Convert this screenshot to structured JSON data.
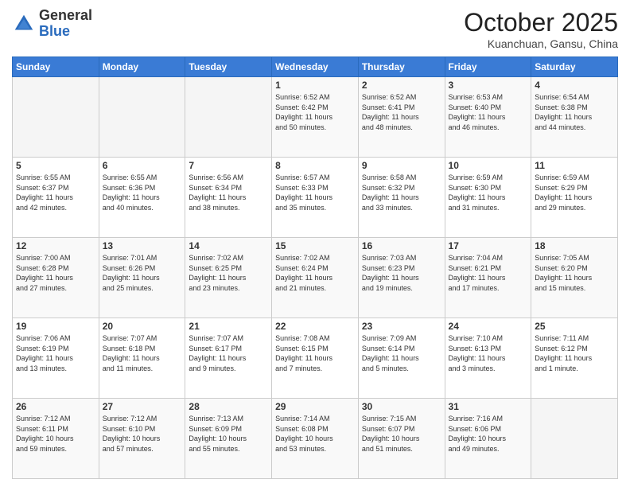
{
  "header": {
    "logo_general": "General",
    "logo_blue": "Blue",
    "month_title": "October 2025",
    "subtitle": "Kuanchuan, Gansu, China"
  },
  "calendar": {
    "headers": [
      "Sunday",
      "Monday",
      "Tuesday",
      "Wednesday",
      "Thursday",
      "Friday",
      "Saturday"
    ],
    "rows": [
      [
        {
          "day": "",
          "info": ""
        },
        {
          "day": "",
          "info": ""
        },
        {
          "day": "",
          "info": ""
        },
        {
          "day": "1",
          "info": "Sunrise: 6:52 AM\nSunset: 6:42 PM\nDaylight: 11 hours\nand 50 minutes."
        },
        {
          "day": "2",
          "info": "Sunrise: 6:52 AM\nSunset: 6:41 PM\nDaylight: 11 hours\nand 48 minutes."
        },
        {
          "day": "3",
          "info": "Sunrise: 6:53 AM\nSunset: 6:40 PM\nDaylight: 11 hours\nand 46 minutes."
        },
        {
          "day": "4",
          "info": "Sunrise: 6:54 AM\nSunset: 6:38 PM\nDaylight: 11 hours\nand 44 minutes."
        }
      ],
      [
        {
          "day": "5",
          "info": "Sunrise: 6:55 AM\nSunset: 6:37 PM\nDaylight: 11 hours\nand 42 minutes."
        },
        {
          "day": "6",
          "info": "Sunrise: 6:55 AM\nSunset: 6:36 PM\nDaylight: 11 hours\nand 40 minutes."
        },
        {
          "day": "7",
          "info": "Sunrise: 6:56 AM\nSunset: 6:34 PM\nDaylight: 11 hours\nand 38 minutes."
        },
        {
          "day": "8",
          "info": "Sunrise: 6:57 AM\nSunset: 6:33 PM\nDaylight: 11 hours\nand 35 minutes."
        },
        {
          "day": "9",
          "info": "Sunrise: 6:58 AM\nSunset: 6:32 PM\nDaylight: 11 hours\nand 33 minutes."
        },
        {
          "day": "10",
          "info": "Sunrise: 6:59 AM\nSunset: 6:30 PM\nDaylight: 11 hours\nand 31 minutes."
        },
        {
          "day": "11",
          "info": "Sunrise: 6:59 AM\nSunset: 6:29 PM\nDaylight: 11 hours\nand 29 minutes."
        }
      ],
      [
        {
          "day": "12",
          "info": "Sunrise: 7:00 AM\nSunset: 6:28 PM\nDaylight: 11 hours\nand 27 minutes."
        },
        {
          "day": "13",
          "info": "Sunrise: 7:01 AM\nSunset: 6:26 PM\nDaylight: 11 hours\nand 25 minutes."
        },
        {
          "day": "14",
          "info": "Sunrise: 7:02 AM\nSunset: 6:25 PM\nDaylight: 11 hours\nand 23 minutes."
        },
        {
          "day": "15",
          "info": "Sunrise: 7:02 AM\nSunset: 6:24 PM\nDaylight: 11 hours\nand 21 minutes."
        },
        {
          "day": "16",
          "info": "Sunrise: 7:03 AM\nSunset: 6:23 PM\nDaylight: 11 hours\nand 19 minutes."
        },
        {
          "day": "17",
          "info": "Sunrise: 7:04 AM\nSunset: 6:21 PM\nDaylight: 11 hours\nand 17 minutes."
        },
        {
          "day": "18",
          "info": "Sunrise: 7:05 AM\nSunset: 6:20 PM\nDaylight: 11 hours\nand 15 minutes."
        }
      ],
      [
        {
          "day": "19",
          "info": "Sunrise: 7:06 AM\nSunset: 6:19 PM\nDaylight: 11 hours\nand 13 minutes."
        },
        {
          "day": "20",
          "info": "Sunrise: 7:07 AM\nSunset: 6:18 PM\nDaylight: 11 hours\nand 11 minutes."
        },
        {
          "day": "21",
          "info": "Sunrise: 7:07 AM\nSunset: 6:17 PM\nDaylight: 11 hours\nand 9 minutes."
        },
        {
          "day": "22",
          "info": "Sunrise: 7:08 AM\nSunset: 6:15 PM\nDaylight: 11 hours\nand 7 minutes."
        },
        {
          "day": "23",
          "info": "Sunrise: 7:09 AM\nSunset: 6:14 PM\nDaylight: 11 hours\nand 5 minutes."
        },
        {
          "day": "24",
          "info": "Sunrise: 7:10 AM\nSunset: 6:13 PM\nDaylight: 11 hours\nand 3 minutes."
        },
        {
          "day": "25",
          "info": "Sunrise: 7:11 AM\nSunset: 6:12 PM\nDaylight: 11 hours\nand 1 minute."
        }
      ],
      [
        {
          "day": "26",
          "info": "Sunrise: 7:12 AM\nSunset: 6:11 PM\nDaylight: 10 hours\nand 59 minutes."
        },
        {
          "day": "27",
          "info": "Sunrise: 7:12 AM\nSunset: 6:10 PM\nDaylight: 10 hours\nand 57 minutes."
        },
        {
          "day": "28",
          "info": "Sunrise: 7:13 AM\nSunset: 6:09 PM\nDaylight: 10 hours\nand 55 minutes."
        },
        {
          "day": "29",
          "info": "Sunrise: 7:14 AM\nSunset: 6:08 PM\nDaylight: 10 hours\nand 53 minutes."
        },
        {
          "day": "30",
          "info": "Sunrise: 7:15 AM\nSunset: 6:07 PM\nDaylight: 10 hours\nand 51 minutes."
        },
        {
          "day": "31",
          "info": "Sunrise: 7:16 AM\nSunset: 6:06 PM\nDaylight: 10 hours\nand 49 minutes."
        },
        {
          "day": "",
          "info": ""
        }
      ]
    ]
  }
}
